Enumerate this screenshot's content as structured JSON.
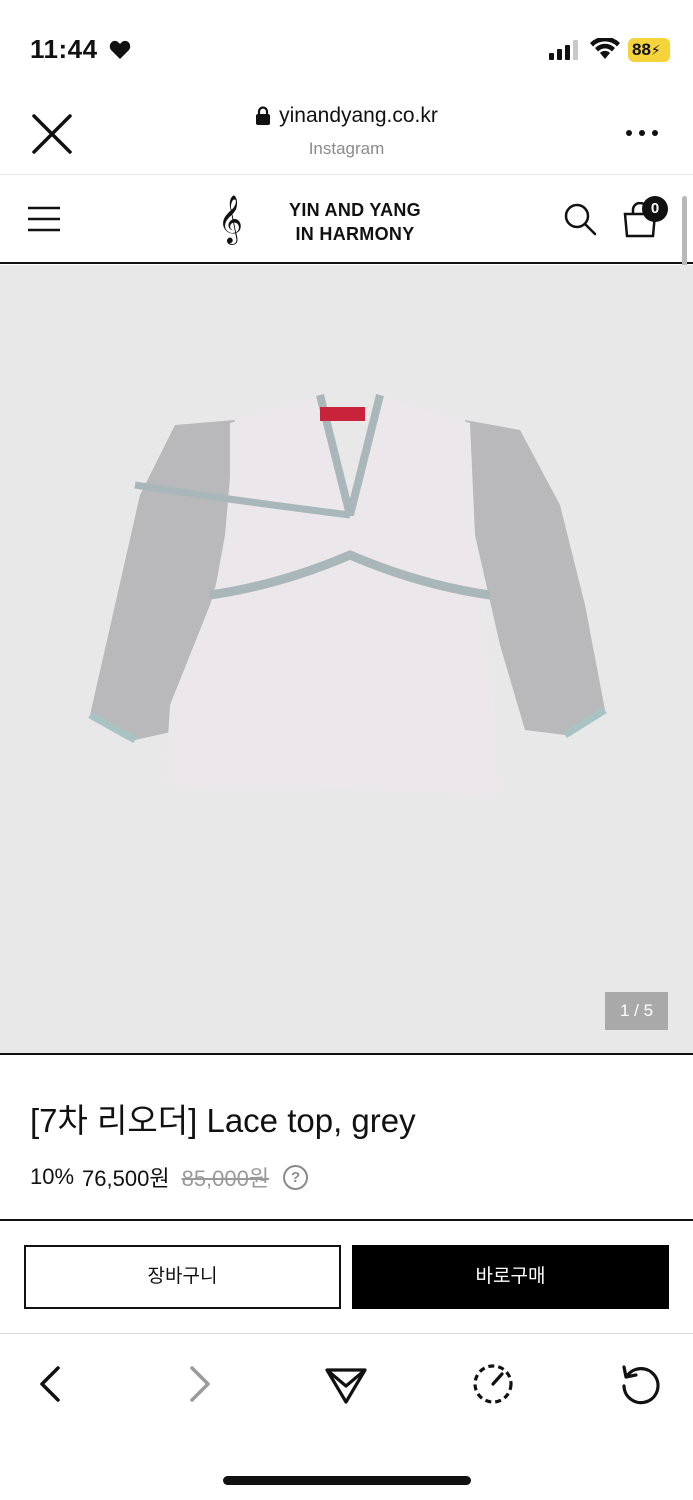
{
  "status_bar": {
    "time": "11:44",
    "battery": "88",
    "icons": [
      "heart-icon",
      "signal-icon",
      "wifi-icon",
      "battery-icon"
    ]
  },
  "browser": {
    "domain": "yinandyang.co.kr",
    "source": "Instagram",
    "icons": [
      "close-icon",
      "lock-icon",
      "more-icon"
    ]
  },
  "header": {
    "logo_symbol": "𝄞",
    "logo_line1": "YIN AND YANG",
    "logo_line2": "IN HARMONY",
    "cart_count": "0",
    "icons": [
      "menu-icon",
      "search-icon",
      "cart-icon"
    ]
  },
  "gallery": {
    "pager": "1 / 5"
  },
  "product": {
    "title": "[7차 리오더] Lace top, grey",
    "discount": "10%",
    "sale_price": "76,500원",
    "original_price": "85,000원",
    "help_symbol": "?"
  },
  "actions": {
    "cart_label": "장바구니",
    "buy_label": "바로구매"
  },
  "toolbar": {
    "icons": [
      "back-icon",
      "forward-icon",
      "share-icon",
      "compass-icon",
      "reload-icon"
    ]
  },
  "colors": {
    "accent": "#000000",
    "battery": "#f4d43a",
    "image_bg": "#e8e8e9",
    "pager_bg": "#a9a9a9"
  }
}
